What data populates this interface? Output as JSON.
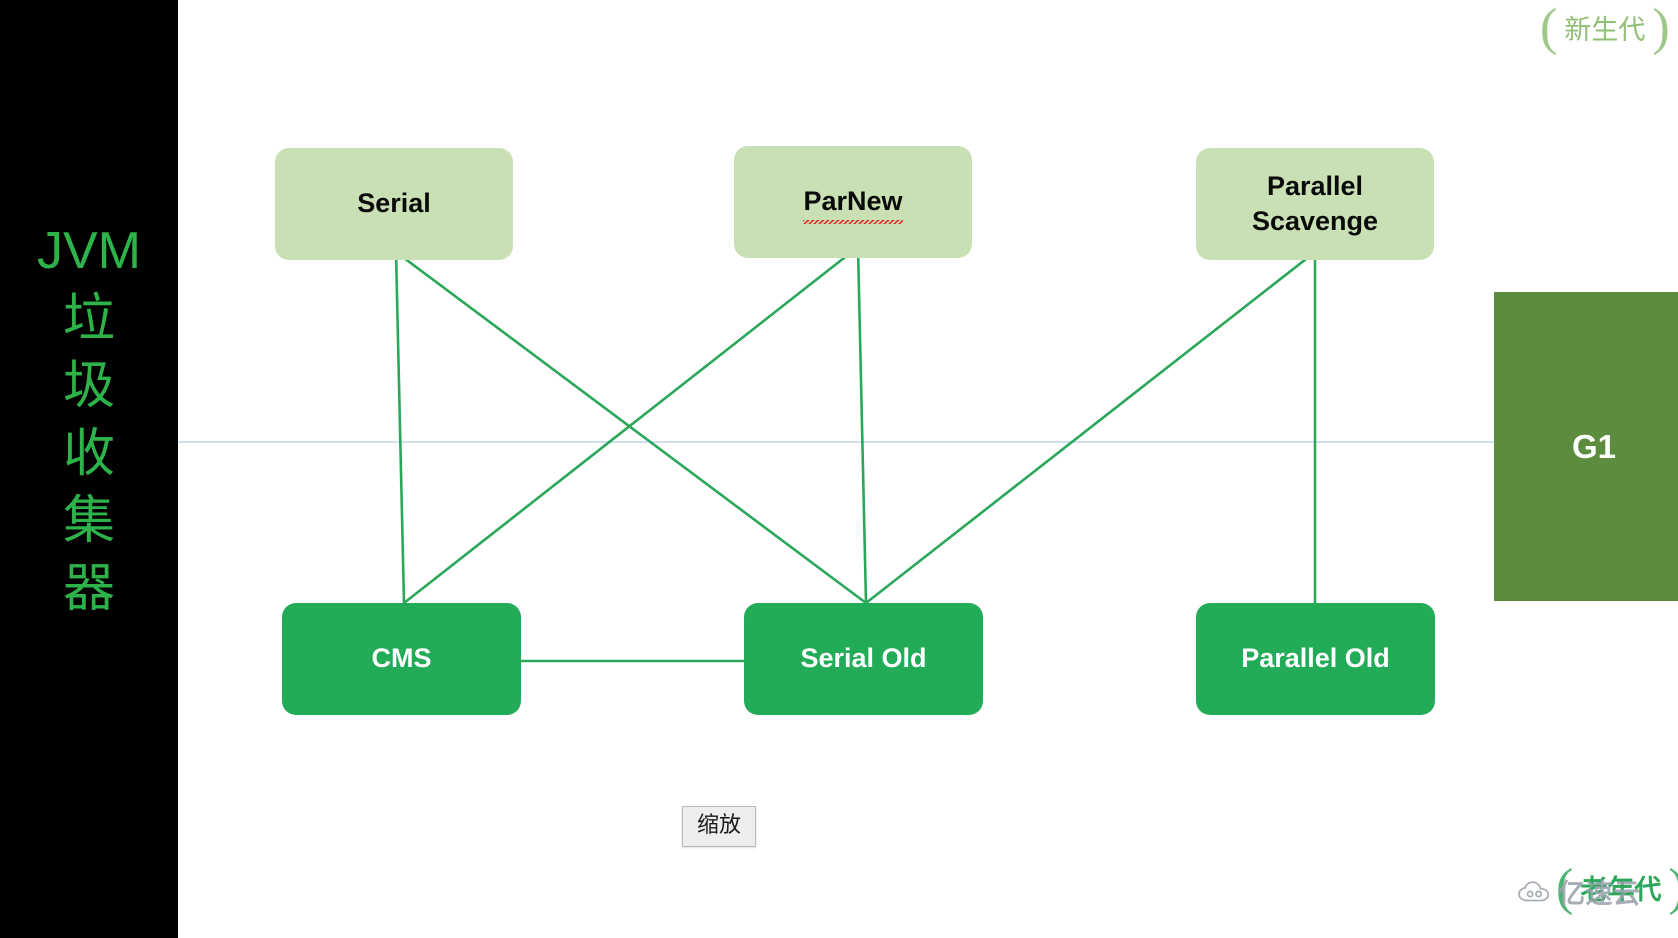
{
  "sidebar": {
    "title": "JVM\n垃\n圾\n收\n集\n器",
    "bg_color": "#000000",
    "text_color": "#2db34a"
  },
  "labels": {
    "young_generation": "新生代",
    "old_generation": "老年代"
  },
  "diagram": {
    "title": "JVM 垃圾收集器",
    "young_nodes": [
      {
        "id": "serial",
        "label": "Serial",
        "spell_error": false
      },
      {
        "id": "parnew",
        "label": "ParNew",
        "spell_error": true
      },
      {
        "id": "parallel-scavenge",
        "label": "Parallel\nScavenge",
        "spell_error": false
      }
    ],
    "old_nodes": [
      {
        "id": "cms",
        "label": "CMS"
      },
      {
        "id": "serial-old",
        "label": "Serial Old"
      },
      {
        "id": "parallel-old",
        "label": "Parallel Old"
      }
    ],
    "g1_node": {
      "id": "g1",
      "label": "G1"
    },
    "edges": [
      {
        "from": "serial",
        "to": "cms"
      },
      {
        "from": "serial",
        "to": "serial-old"
      },
      {
        "from": "parnew",
        "to": "cms"
      },
      {
        "from": "parnew",
        "to": "serial-old"
      },
      {
        "from": "parallel-scavenge",
        "to": "serial-old"
      },
      {
        "from": "parallel-scavenge",
        "to": "parallel-old"
      },
      {
        "from": "cms",
        "to": "serial-old"
      }
    ]
  },
  "colors": {
    "young_box": "#c8e0b3",
    "old_box": "#22ac58",
    "g1_box": "#5c8c3e",
    "connector": "#2aa75a",
    "guide_line": "#cfe0f2",
    "spell_underline": "#e02020",
    "sidebar_text": "#2db34a",
    "chip_young": "#8fbe74"
  },
  "zoom_tooltip": {
    "label": "缩放"
  },
  "watermark": {
    "text": "亿速云",
    "icon": "cloud-icon"
  }
}
